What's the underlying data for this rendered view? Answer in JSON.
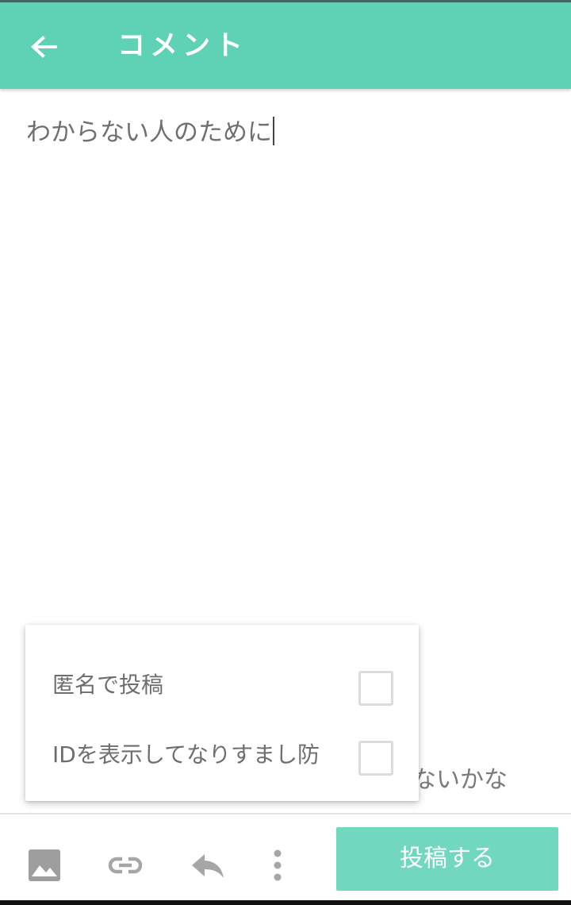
{
  "appbar": {
    "title": "コメント",
    "back_icon": "arrow-left-icon",
    "background": "#5fd1b4"
  },
  "editor": {
    "text": "わからない人のために",
    "behind_text": "ないかな"
  },
  "options_popup": {
    "items": [
      {
        "label": "匿名で投稿",
        "checked": false
      },
      {
        "label": "IDを表示してなりすまし防",
        "checked": false
      }
    ]
  },
  "toolbar": {
    "icons": [
      "image-icon",
      "link-icon",
      "reply-icon",
      "more-vert-icon"
    ],
    "post_label": "投稿する",
    "post_color": "#71d7be"
  }
}
